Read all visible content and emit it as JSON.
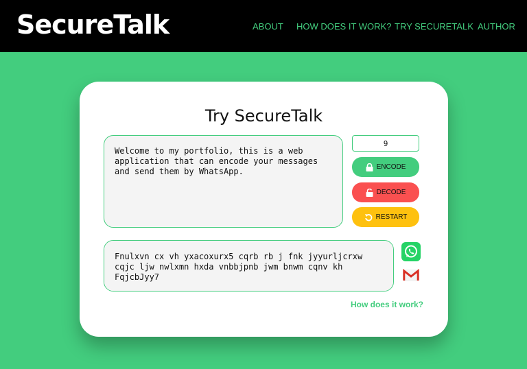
{
  "brand": "SecureTalk",
  "nav": [
    "ABOUT",
    "HOW DOES IT WORK?",
    "TRY SECURETALK",
    "AUTHOR"
  ],
  "card": {
    "title": "Try SecureTalk",
    "input_text": "Welcome to my portfolio, this is a web application that can encode your messages and send them by WhatsApp.",
    "key_value": "9",
    "buttons": {
      "encode": "ENCODE",
      "decode": "DECODE",
      "restart": "RESTART"
    },
    "output_text": "Fnulxvn cx vh yxacoxurx5 cqrb rb j fnk jyyurljcrxw cqjc ljw nwlxmn hxda vnbbjpnb jwm bnwm cqnv kh FqjcbJyy7",
    "help_link": "How does it work?"
  },
  "icons": {
    "encode": "lock-icon",
    "decode": "unlock-icon",
    "restart": "restart-icon",
    "share_whatsapp": "whatsapp-icon",
    "share_gmail": "gmail-icon"
  },
  "colors": {
    "background": "#43cd7e",
    "navbar": "#000000",
    "accent": "#43cd7e",
    "encode": "#43cd7e",
    "decode": "#fa5050",
    "restart": "#fec10f"
  }
}
